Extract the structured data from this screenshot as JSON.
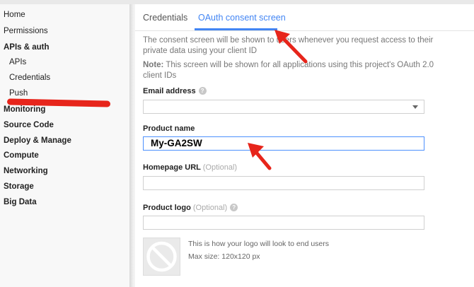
{
  "sidebar": {
    "items": [
      {
        "label": "Home",
        "bold": false
      },
      {
        "label": "Permissions",
        "bold": false
      },
      {
        "label": "APIs & auth",
        "bold": true
      },
      {
        "label": "APIs",
        "bold": false
      },
      {
        "label": "Credentials",
        "bold": false
      },
      {
        "label": "Push",
        "bold": false
      },
      {
        "label": "Monitoring",
        "bold": true
      },
      {
        "label": "Source Code",
        "bold": true
      },
      {
        "label": "Deploy & Manage",
        "bold": true
      },
      {
        "label": "Compute",
        "bold": true
      },
      {
        "label": "Networking",
        "bold": true
      },
      {
        "label": "Storage",
        "bold": true
      },
      {
        "label": "Big Data",
        "bold": true
      }
    ]
  },
  "tabs": [
    {
      "label": "Credentials",
      "active": false
    },
    {
      "label": "OAuth consent screen",
      "active": true
    }
  ],
  "content": {
    "intro": "The consent screen will be shown to users whenever you request access to their private data using your client ID",
    "note_label": "Note:",
    "note_text": " This screen will be shown for all applications using this project's OAuth 2.0 client IDs"
  },
  "form": {
    "email_label": "Email address",
    "email_value": "",
    "product_name_label": "Product name",
    "product_name_value": "My-GA2SW",
    "homepage_label": "Homepage URL",
    "homepage_optional": "(Optional)",
    "homepage_value": "",
    "logo_label": "Product logo",
    "logo_optional": "(Optional)",
    "logo_value": "",
    "logo_hint_line1": "This is how your logo will look to end users",
    "logo_hint_line2": "Max size: 120x120 px"
  },
  "colors": {
    "accent": "#4285f4",
    "annotation_red": "#e7251b",
    "sidebar_bg": "#f8f8f8"
  }
}
